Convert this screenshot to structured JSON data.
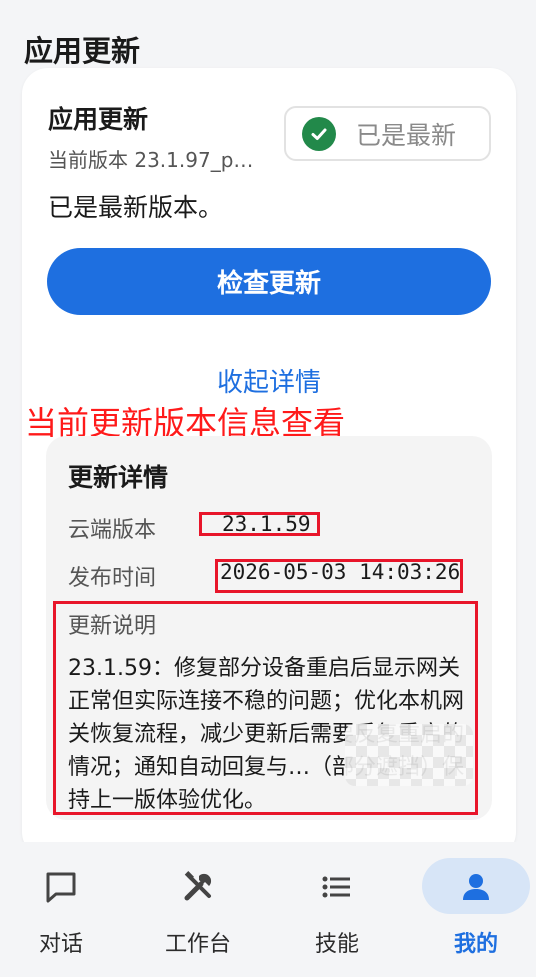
{
  "page": {
    "title": "应用更新"
  },
  "update_card": {
    "title": "应用更新",
    "current_version": "当前版本 23.1.97_p…",
    "status_badge": {
      "label": "已是最新",
      "icon": "check-circle-icon",
      "color": "#22894a"
    },
    "status_message": "已是最新版本。",
    "check_button_label": "检查更新",
    "collapse_link": "收起详情",
    "annotation_text": "当前更新版本信息查看",
    "details": {
      "title": "更新详情",
      "cloud_version_label": "云端版本",
      "cloud_version_value": "23.1.59",
      "release_time_label": "发布时间",
      "release_time_value": "2026-05-03 14:03:26",
      "notes_label": "更新说明",
      "notes_text": "23.1.59：修复部分设备重启后显示网关正常但实际连接不稳的问题；优化本机网关恢复流程，减少更新后需要反复重启的情况；通知自动回复与…（部分遮挡）保持上一版体验优化。"
    }
  },
  "bottom_nav": {
    "items": [
      {
        "label": "对话",
        "icon": "chat-bubble-icon",
        "active": false
      },
      {
        "label": "工作台",
        "icon": "tools-icon",
        "active": false
      },
      {
        "label": "技能",
        "icon": "list-icon",
        "active": false
      },
      {
        "label": "我的",
        "icon": "person-icon",
        "active": true
      }
    ]
  },
  "colors": {
    "accent": "#1e6fe0",
    "annotation_red": "#ff1a1a",
    "success_green": "#22894a"
  }
}
